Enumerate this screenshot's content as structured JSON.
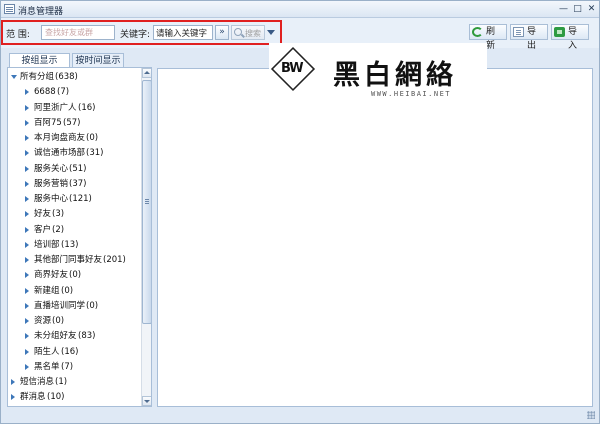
{
  "window": {
    "title": "消息管理器",
    "controls": {
      "minimize": "—",
      "maximize": "□",
      "close": "✕"
    }
  },
  "toolbar": {
    "range_label": "范  围:",
    "search_placeholder": "查找好友或群",
    "keyword_label": "关键字:",
    "keyword_value": "请输入关键字",
    "more_label": "»",
    "search_button": "搜索",
    "refresh_button": "刷新",
    "export_button": "导出",
    "import_button": "导入",
    "icons": {
      "search": "magnifier-icon",
      "refresh": "refresh-icon",
      "export": "export-icon",
      "import": "import-icon"
    }
  },
  "tabs": [
    {
      "label": "按组显示",
      "active": true
    },
    {
      "label": "按时间显示",
      "active": false
    }
  ],
  "tree": {
    "items": [
      {
        "label": "所有分组",
        "count": "(638)",
        "expanded": true,
        "level": 0
      },
      {
        "label": "6688",
        "count": "(7)",
        "level": 1
      },
      {
        "label": "阿里浙广人",
        "count": "(16)",
        "level": 1
      },
      {
        "label": "百阿75",
        "count": "(57)",
        "level": 1
      },
      {
        "label": "本月询盘商友",
        "count": "(0)",
        "level": 1
      },
      {
        "label": "诚信通市场部",
        "count": "(31)",
        "level": 1
      },
      {
        "label": "服务关心",
        "count": "(51)",
        "level": 1
      },
      {
        "label": "服务营销",
        "count": "(37)",
        "level": 1
      },
      {
        "label": "服务中心",
        "count": "(121)",
        "level": 1
      },
      {
        "label": "好友",
        "count": "(3)",
        "level": 1
      },
      {
        "label": "客户",
        "count": "(2)",
        "level": 1
      },
      {
        "label": "培训部",
        "count": "(13)",
        "level": 1
      },
      {
        "label": "其他部门同事好友",
        "count": "(201)",
        "level": 1
      },
      {
        "label": "商界好友",
        "count": "(0)",
        "level": 1
      },
      {
        "label": "新建组",
        "count": "(0)",
        "level": 1
      },
      {
        "label": "直播培训同学",
        "count": "(0)",
        "level": 1
      },
      {
        "label": "资源",
        "count": "(0)",
        "level": 1
      },
      {
        "label": "未分组好友",
        "count": "(83)",
        "level": 1
      },
      {
        "label": "陌生人",
        "count": "(16)",
        "level": 1
      },
      {
        "label": "黑名单",
        "count": "(7)",
        "level": 1
      },
      {
        "label": "短信消息",
        "count": "(1)",
        "level": 0
      },
      {
        "label": "群消息",
        "count": "(10)",
        "level": 0
      }
    ]
  },
  "watermark": {
    "logo_text": "BW",
    "brand": "黑白網絡",
    "url": "WWW.HEIBAI.NET"
  },
  "colors": {
    "highlight": "#e02020",
    "tree_triangle": "#3d77b9",
    "panel_bg": "#dfe9f5"
  }
}
